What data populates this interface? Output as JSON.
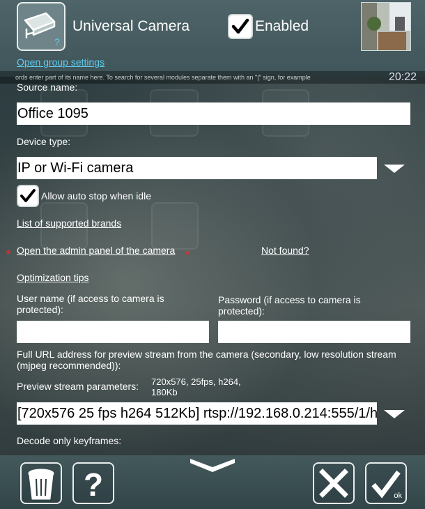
{
  "header": {
    "title": "Universal Camera",
    "enabled_label": "Enabled",
    "group_link": "Open group settings",
    "hint_strip": "ords enter part of its name here. To search for several modules separate them with an \"|\" sign, for example",
    "clock": "20:22"
  },
  "form": {
    "source_name_label": "Source name:",
    "source_name_value": "Office 1095",
    "device_type_label": "Device type:",
    "device_type_value": "IP or Wi-Fi camera",
    "auto_stop_label": "Allow auto stop when idle",
    "brands_link": "List of supported brands",
    "admin_link": "Open the admin panel of the camera",
    "not_found_link": "Not found?",
    "optimization_link": "Optimization tips",
    "username_label": "User name (if access to camera is protected):",
    "username_value": "",
    "password_label": "Password (if access to camera is protected):",
    "password_value": "",
    "url_label": "Full URL address for preview stream from the camera (secondary, low resolution stream (mjpeg recommended)):",
    "stream_params_label": "Preview stream parameters:",
    "stream_params_value": "720x576, 25fps, h264, 180Kb",
    "url_value": "[720x576 25 fps h264 512Kb] rtsp://192.168.0.214:555/1/h",
    "decode_label": "Decode only keyframes:"
  },
  "footer": {
    "ok_label": "ok"
  },
  "colors": {
    "header_bg": "#4e6468",
    "link_accent": "#5ecdf0",
    "required_star": "#e23030"
  },
  "icons": [
    "camera-icon",
    "checkmark-icon",
    "chevron-down-icon",
    "trash-icon",
    "help-icon",
    "close-icon",
    "ok-icon"
  ]
}
